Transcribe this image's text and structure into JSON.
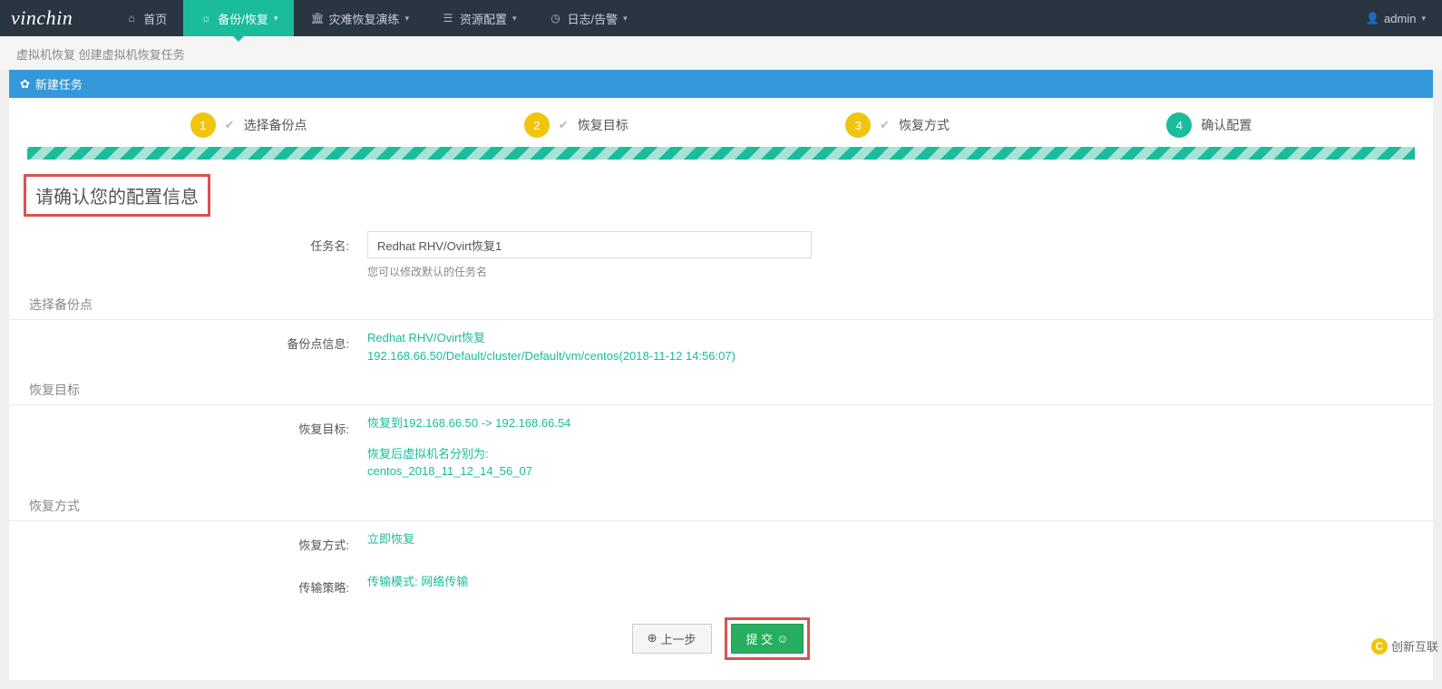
{
  "brand": "vinchin",
  "nav": {
    "home": "首页",
    "backup": "备份/恢复",
    "drill": "灾难恢复演练",
    "resource": "资源配置",
    "log": "日志/告警"
  },
  "user": {
    "name": "admin"
  },
  "breadcrumb": "虚拟机恢复 创建虚拟机恢复任务",
  "panelTitle": "新建任务",
  "steps": [
    {
      "num": "1",
      "label": "选择备份点"
    },
    {
      "num": "2",
      "label": "恢复目标"
    },
    {
      "num": "3",
      "label": "恢复方式"
    },
    {
      "num": "4",
      "label": "确认配置"
    }
  ],
  "sectionTitle": "请确认您的配置信息",
  "taskNameLabel": "任务名:",
  "taskNameValue": "Redhat RHV/Ovirt恢复1",
  "taskNameHint": "您可以修改默认的任务名",
  "backupPointHeader": "选择备份点",
  "backupPointLabel": "备份点信息:",
  "backupPointLine1": "Redhat RHV/Ovirt恢复",
  "backupPointLine2": "192.168.66.50/Default/cluster/Default/vm/centos(2018-11-12 14:56:07)",
  "restoreTargetHeader": "恢复目标",
  "restoreTargetLabel": "恢复目标:",
  "restoreTargetLine1": "恢复到192.168.66.50 -> 192.168.66.54",
  "restoreTargetLine2": "恢复后虚拟机名分别为:",
  "restoreTargetLine3": "centos_2018_11_12_14_56_07",
  "restoreModeHeader": "恢复方式",
  "restoreModeLabel": "恢复方式:",
  "restoreModeValue": "立即恢复",
  "transferLabel": "传输策略:",
  "transferValue": "传输模式: 网络传输",
  "btnPrev": "上一步",
  "btnSubmit": "提 交",
  "watermark": "创新互联",
  "colors": {
    "teal": "#1abc9c",
    "blue": "#3498db",
    "yellow": "#f1c40f",
    "green": "#27ae60",
    "red": "#d9534f",
    "navDark": "#2a3542"
  }
}
